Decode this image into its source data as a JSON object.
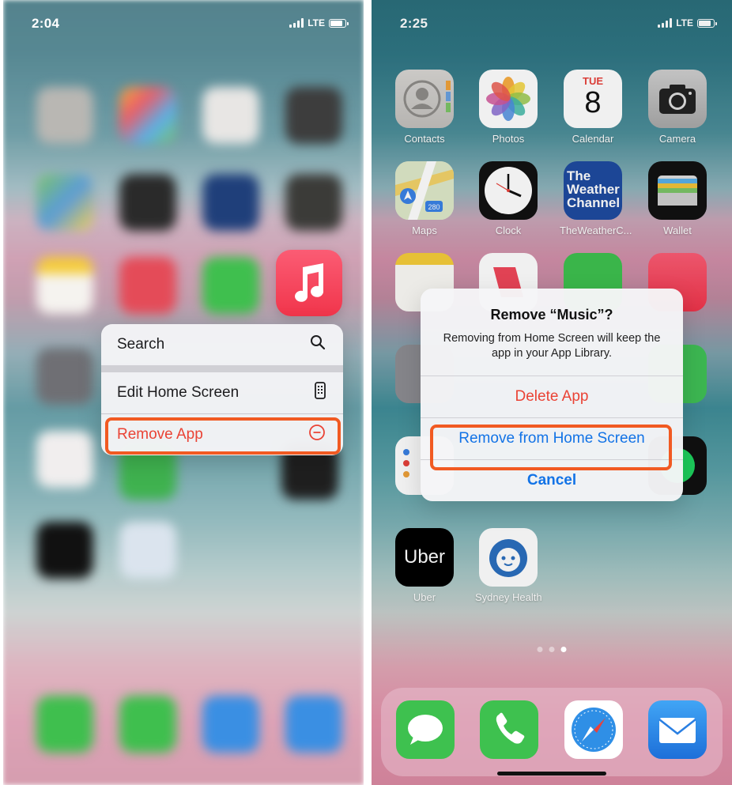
{
  "left": {
    "status": {
      "time": "2:04",
      "network": "LTE"
    },
    "menu": {
      "search_label": "Search",
      "edit_label": "Edit Home Screen",
      "remove_label": "Remove App"
    }
  },
  "right": {
    "status": {
      "time": "2:25",
      "network": "LTE"
    },
    "apps": {
      "contacts": "Contacts",
      "photos": "Photos",
      "calendar": "Calendar",
      "calendar_day": "TUE",
      "calendar_date": "8",
      "camera": "Camera",
      "maps": "Maps",
      "clock": "Clock",
      "weather": "TheWeatherC...",
      "weather_logo": [
        "The",
        "Weather",
        "Channel"
      ],
      "wallet": "Wallet",
      "uber": "Uber",
      "uber_logo": "Uber",
      "sydney": "Sydney Health"
    },
    "alert": {
      "title": "Remove “Music”?",
      "message": "Removing from Home Screen will keep the app in your App Library.",
      "delete_label": "Delete App",
      "remove_label": "Remove from Home Screen",
      "cancel_label": "Cancel"
    }
  },
  "colors": {
    "accent_red": "#ea4335",
    "ios_blue": "#1273e6",
    "highlight": "#f15a22"
  },
  "icons": [
    "search-icon",
    "phone-edit-icon",
    "minus-circle-icon",
    "music-icon",
    "messages-icon",
    "phone-icon",
    "safari-icon",
    "mail-icon"
  ]
}
